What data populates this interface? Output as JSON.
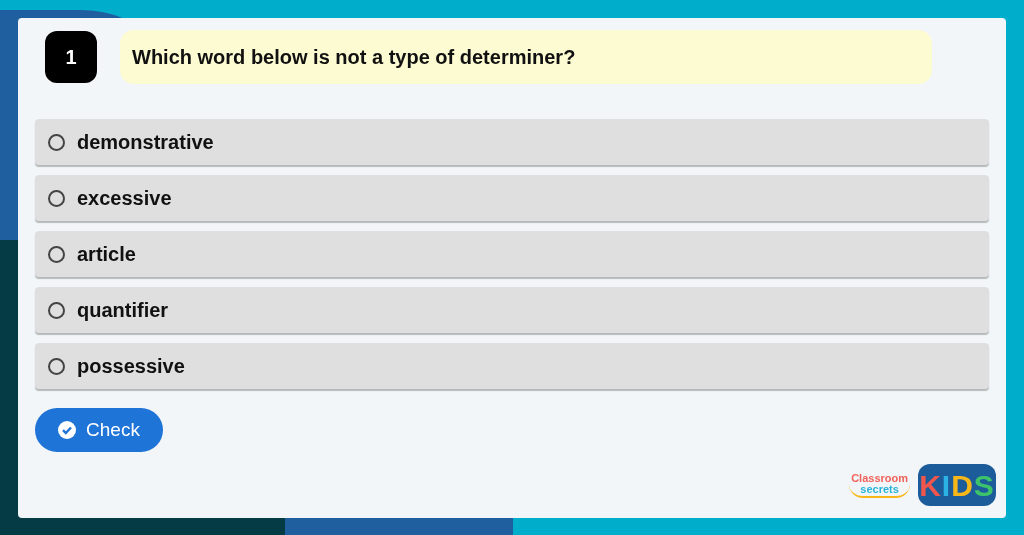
{
  "question": {
    "number": "1",
    "text": "Which word below is not a type of determiner?"
  },
  "options": [
    {
      "label": "demonstrative",
      "selected": false
    },
    {
      "label": "excessive",
      "selected": false
    },
    {
      "label": "article",
      "selected": false
    },
    {
      "label": "quantifier",
      "selected": false
    },
    {
      "label": "possessive",
      "selected": false
    }
  ],
  "check_button": {
    "label": "Check"
  },
  "logo": {
    "top": "Classroom",
    "bottom": "secrets",
    "badge": "KIDS"
  }
}
